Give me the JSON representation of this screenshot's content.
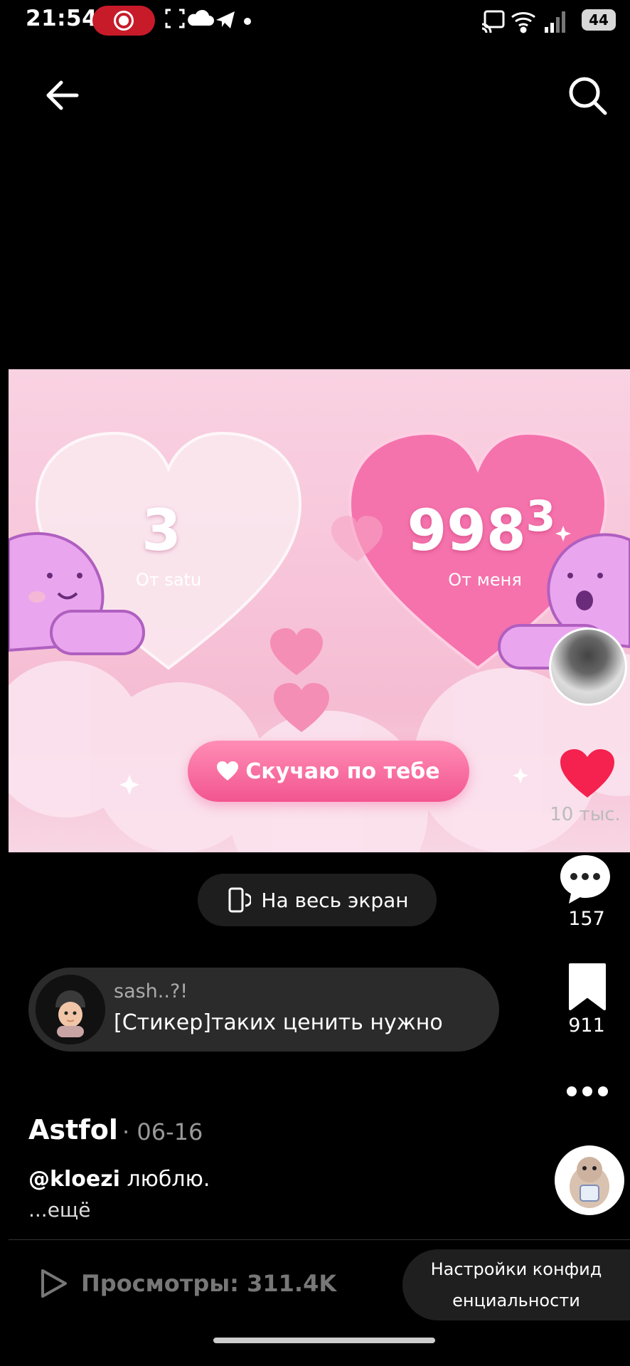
{
  "status_bar": {
    "time": "21:54",
    "battery": "44"
  },
  "top_bar": {
    "back_icon": "arrow-left-icon",
    "search_icon": "search-icon"
  },
  "video": {
    "left_count": "3",
    "left_label": "От satu",
    "right_count_main": "998",
    "right_count_sup": "3",
    "right_label": "От меня",
    "button_label": "Скучаю по тебе"
  },
  "actions": {
    "likes": "10 тыс.",
    "comments": "157",
    "saves": "911"
  },
  "fullscreen": {
    "label": "На весь экран"
  },
  "comment_preview": {
    "user": "sash..?!",
    "text": "[Стикер]таких ценить нужно"
  },
  "post": {
    "author": "Astfol",
    "date": "· 06-16",
    "mention": "@kloezi",
    "caption": " люблю.",
    "more": "...ещё"
  },
  "bottom_bar": {
    "views": "Просмотры: 311.4K",
    "privacy_line1": "Настройки конфид",
    "privacy_line2": "енциальности"
  },
  "colors": {
    "accent_heart": "#f5214e",
    "button_pink": "#f25590",
    "record_red": "#c81b2a"
  }
}
